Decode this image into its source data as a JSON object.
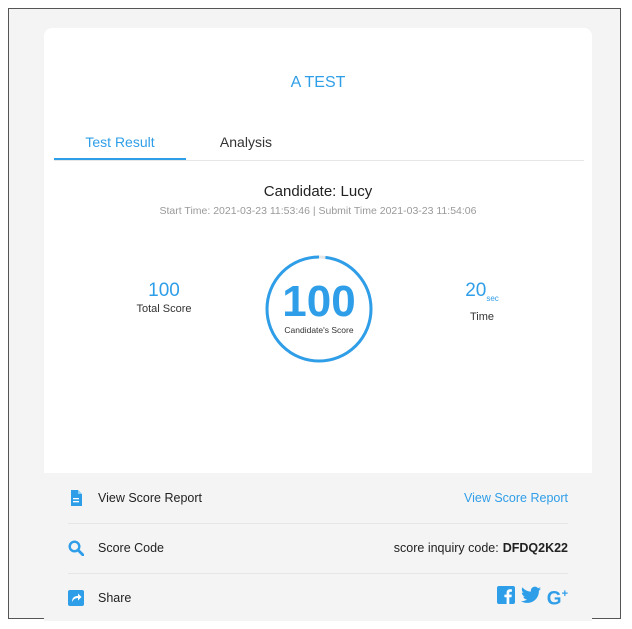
{
  "header": {
    "title": "A TEST"
  },
  "tabs": [
    {
      "label": "Test Result"
    },
    {
      "label": "Analysis"
    }
  ],
  "result": {
    "candidate": "Candidate: Lucy",
    "times": "Start Time:  2021-03-23 11:53:46 | Submit Time 2021-03-23 11:54:06",
    "total_score": "100",
    "total_score_label": "Total Score",
    "candidate_score": "100",
    "candidate_score_label": "Candidate's Score",
    "time_value": "20",
    "time_unit": "sec",
    "time_label": "Time",
    "score_fraction": 0.98
  },
  "footer": {
    "report_label": "View Score Report",
    "report_link": "View Score Report",
    "code_label": "Score Code",
    "code_prefix": "score inquiry code:",
    "code_value": "DFDQ2K22",
    "share_label": "Share"
  },
  "icons": {
    "report": "document-icon",
    "code": "search-icon",
    "share": "share-icon",
    "facebook": "facebook-icon",
    "twitter": "twitter-icon",
    "google": "google-plus-icon"
  },
  "colors": {
    "accent": "#2f9ee8",
    "muted": "#999999",
    "panel": "#f4f4f4"
  }
}
